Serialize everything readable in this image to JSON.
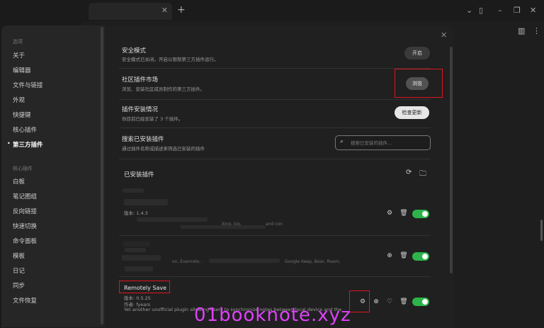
{
  "window": {
    "tab_close": "✕",
    "tab_add": "+"
  },
  "sidebar": {
    "section_options": "选项",
    "options": [
      "关于",
      "编辑器",
      "文件与链接",
      "外观",
      "快捷键",
      "核心插件",
      "第三方插件"
    ],
    "active_item": "第三方插件",
    "section_core": "核心插件",
    "core": [
      "白板",
      "笔记图组",
      "反向链接",
      "快速切换",
      "命令面板",
      "模板",
      "日记",
      "同步",
      "文件恢复"
    ]
  },
  "settings": {
    "safe_mode": {
      "title": "安全模式",
      "desc": "安全模式已关闭。开启以限制第三方插件运行。",
      "button": "开启"
    },
    "market": {
      "title": "社区插件市场",
      "desc": "浏览、安装社区成员制作的第三方插件。",
      "button": "浏览"
    },
    "status": {
      "title": "插件安装情况",
      "desc": "你目前已经安装了 3 个插件。",
      "button": "检查更新"
    },
    "search": {
      "title": "搜索已安装插件",
      "desc": "通过插件名称或描述来筛选已安装的插件",
      "placeholder": "搜索已安装的插件..."
    },
    "installed_title": "已安装插件"
  },
  "plugins": [
    {
      "version": "版本: 1.4.3",
      "desc_fragment": "iting, kio,",
      "desc_fragment2": "and con"
    },
    {
      "desc_fragment": "on, Evernote, ·",
      "desc_fragment2": "Google Keep, Bear, Roam,"
    },
    {
      "name": "Remotely Save",
      "version": "版本: 0.5.25",
      "author": "作者: fyears",
      "desc": "Yet another unofficial plugin allowing users to synchronize notes between local device and the"
    }
  ],
  "watermark": "01booknote.xyz",
  "colors": {
    "toggle_on": "#2db34a",
    "highlight": "#e0141e",
    "watermark": "#e040fb"
  }
}
